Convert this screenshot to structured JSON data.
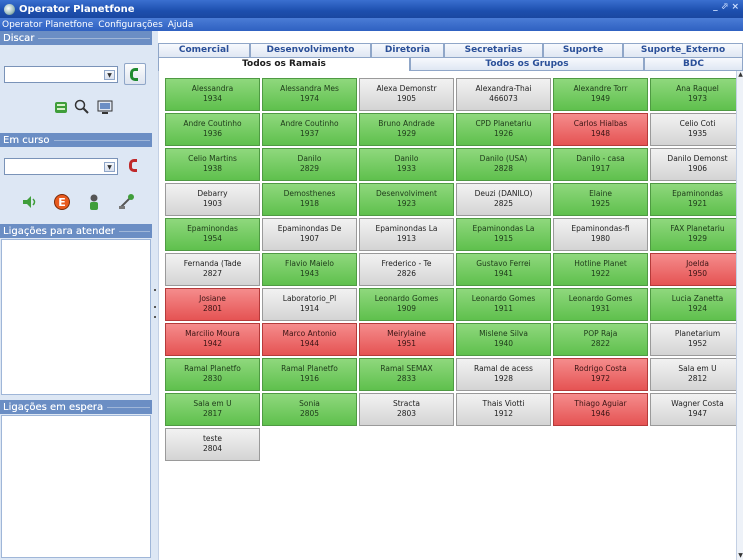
{
  "window": {
    "title": "Operator Planetfone",
    "controls": "_ ⬀ ×"
  },
  "menu": [
    "Operator Planetfone",
    "Configurações",
    "Ajuda"
  ],
  "left": {
    "discar_title": "Discar",
    "emcurso_title": "Em curso",
    "atender_title": "Ligações para atender",
    "espera_title": "Ligações em espera"
  },
  "tabs_top": [
    "Comercial",
    "Desenvolvimento",
    "Diretoria",
    "Secretarias",
    "Suporte",
    "Suporte_Externo"
  ],
  "tabs_sub": [
    "Todos os Ramais",
    "Todos os Grupos",
    "BDC"
  ],
  "active_sub_tab": "Todos os Ramais",
  "colors": {
    "green": "#6bc759",
    "red": "#ea6565",
    "grey": "#dcdcdc"
  },
  "ramais": [
    {
      "name": "Alessandra",
      "ext": "1934",
      "status": "green"
    },
    {
      "name": "Alessandra Mes",
      "ext": "1974",
      "status": "green"
    },
    {
      "name": "Alexa Demonstr",
      "ext": "1905",
      "status": "grey"
    },
    {
      "name": "Alexandra-Thai",
      "ext": "466073",
      "status": "grey"
    },
    {
      "name": "Alexandre Torr",
      "ext": "1949",
      "status": "green"
    },
    {
      "name": "Ana Raquel",
      "ext": "1973",
      "status": "green"
    },
    {
      "name": "Andre Coutinho",
      "ext": "1936",
      "status": "green"
    },
    {
      "name": "Andre Coutinho",
      "ext": "1937",
      "status": "green"
    },
    {
      "name": "Bruno Andrade",
      "ext": "1929",
      "status": "green"
    },
    {
      "name": "CPD Planetariu",
      "ext": "1926",
      "status": "green"
    },
    {
      "name": "Carlos Hialbas",
      "ext": "1948",
      "status": "red"
    },
    {
      "name": "Celio Coti",
      "ext": "1935",
      "status": "grey"
    },
    {
      "name": "Celio Martins",
      "ext": "1938",
      "status": "green"
    },
    {
      "name": "Danilo",
      "ext": "2829",
      "status": "green"
    },
    {
      "name": "Danilo",
      "ext": "1933",
      "status": "green"
    },
    {
      "name": "Danilo (USA)",
      "ext": "2828",
      "status": "green"
    },
    {
      "name": "Danilo - casa",
      "ext": "1917",
      "status": "green"
    },
    {
      "name": "Danilo Demonst",
      "ext": "1906",
      "status": "grey"
    },
    {
      "name": "Debarry",
      "ext": "1903",
      "status": "grey"
    },
    {
      "name": "Demosthenes",
      "ext": "1918",
      "status": "green"
    },
    {
      "name": "Desenvolviment",
      "ext": "1923",
      "status": "green"
    },
    {
      "name": "Deuzi (DANILO)",
      "ext": "2825",
      "status": "grey"
    },
    {
      "name": "Elaine",
      "ext": "1925",
      "status": "green"
    },
    {
      "name": "Epaminondas",
      "ext": "1921",
      "status": "green"
    },
    {
      "name": "Epaminondas",
      "ext": "1954",
      "status": "green"
    },
    {
      "name": "Epaminondas De",
      "ext": "1907",
      "status": "grey"
    },
    {
      "name": "Epaminondas La",
      "ext": "1913",
      "status": "grey"
    },
    {
      "name": "Epaminondas La",
      "ext": "1915",
      "status": "green"
    },
    {
      "name": "Epaminondas-fi",
      "ext": "1980",
      "status": "grey"
    },
    {
      "name": "FAX Planetariu",
      "ext": "1929",
      "status": "green"
    },
    {
      "name": "Fernanda (Tade",
      "ext": "2827",
      "status": "grey"
    },
    {
      "name": "Flavio Maielo",
      "ext": "1943",
      "status": "green"
    },
    {
      "name": "Frederico - Te",
      "ext": "2826",
      "status": "grey"
    },
    {
      "name": "Gustavo Ferrei",
      "ext": "1941",
      "status": "green"
    },
    {
      "name": "Hotline Planet",
      "ext": "1922",
      "status": "green"
    },
    {
      "name": "Joelda",
      "ext": "1950",
      "status": "red"
    },
    {
      "name": "Josiane",
      "ext": "2801",
      "status": "red"
    },
    {
      "name": "Laboratorio_Pl",
      "ext": "1914",
      "status": "grey"
    },
    {
      "name": "Leonardo Gomes",
      "ext": "1909",
      "status": "green"
    },
    {
      "name": "Leonardo Gomes",
      "ext": "1911",
      "status": "green"
    },
    {
      "name": "Leonardo Gomes",
      "ext": "1931",
      "status": "green"
    },
    {
      "name": "Lucia Zanetta",
      "ext": "1924",
      "status": "green"
    },
    {
      "name": "Marcilio Moura",
      "ext": "1942",
      "status": "red"
    },
    {
      "name": "Marco Antonio",
      "ext": "1944",
      "status": "red"
    },
    {
      "name": "Meirylaine",
      "ext": "1951",
      "status": "red"
    },
    {
      "name": "Mislene Silva",
      "ext": "1940",
      "status": "green"
    },
    {
      "name": "POP Raja",
      "ext": "2822",
      "status": "green"
    },
    {
      "name": "Planetarium",
      "ext": "1952",
      "status": "grey"
    },
    {
      "name": "Ramal Planetfo",
      "ext": "2830",
      "status": "green"
    },
    {
      "name": "Ramal Planetfo",
      "ext": "1916",
      "status": "green"
    },
    {
      "name": "Ramal SEMAX",
      "ext": "2833",
      "status": "green"
    },
    {
      "name": "Ramal de acess",
      "ext": "1928",
      "status": "grey"
    },
    {
      "name": "Rodrigo Costa",
      "ext": "1972",
      "status": "red"
    },
    {
      "name": "Sala em U",
      "ext": "2812",
      "status": "grey"
    },
    {
      "name": "Sala em U",
      "ext": "2817",
      "status": "green"
    },
    {
      "name": "Sonia",
      "ext": "2805",
      "status": "green"
    },
    {
      "name": "Stracta",
      "ext": "2803",
      "status": "grey"
    },
    {
      "name": "Thais Viotti",
      "ext": "1912",
      "status": "grey"
    },
    {
      "name": "Thiago Aguiar",
      "ext": "1946",
      "status": "red"
    },
    {
      "name": "Wagner Costa",
      "ext": "1947",
      "status": "grey"
    },
    {
      "name": "teste",
      "ext": "2804",
      "status": "grey"
    }
  ]
}
